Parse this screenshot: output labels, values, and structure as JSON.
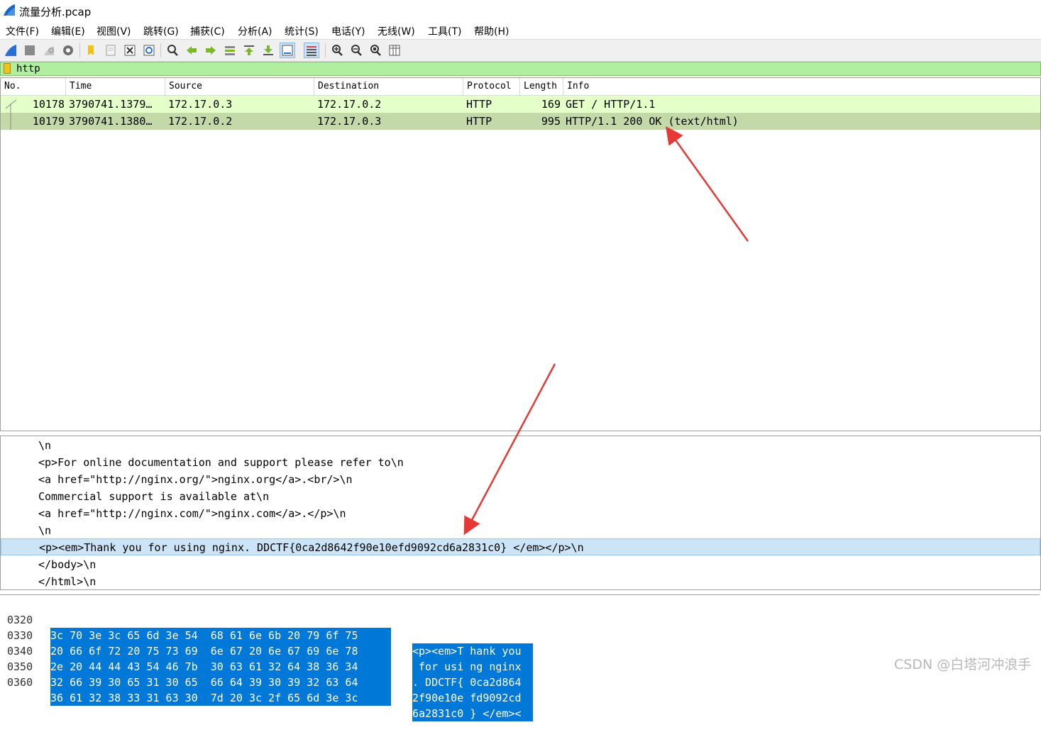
{
  "window": {
    "title": "流量分析.pcap"
  },
  "menu": [
    "文件(F)",
    "编辑(E)",
    "视图(V)",
    "跳转(G)",
    "捕获(C)",
    "分析(A)",
    "统计(S)",
    "电话(Y)",
    "无线(W)",
    "工具(T)",
    "帮助(H)"
  ],
  "toolbar": {
    "icons": [
      "shark-fin-start-icon",
      "stop-capture-icon",
      "restart-capture-icon",
      "capture-options-icon",
      "open-file-icon",
      "save-file-icon",
      "close-file-icon",
      "reload-file-icon",
      "find-packet-icon",
      "go-back-icon",
      "go-forward-icon",
      "go-to-packet-icon",
      "go-first-packet-icon",
      "go-last-packet-icon",
      "auto-scroll-icon",
      "colorize-icon",
      "zoom-in-icon",
      "zoom-out-icon",
      "normal-size-icon",
      "resize-columns-icon"
    ]
  },
  "filter": {
    "value": "http"
  },
  "packet_list": {
    "columns": [
      "No.",
      "Time",
      "Source",
      "Destination",
      "Protocol",
      "Length",
      "Info"
    ],
    "rows": [
      {
        "no": "10178",
        "time": "3790741.1379…",
        "source": "172.17.0.3",
        "destination": "172.17.0.2",
        "protocol": "HTTP",
        "length": "169",
        "info": "GET / HTTP/1.1"
      },
      {
        "no": "10179",
        "time": "3790741.1380…",
        "source": "172.17.0.2",
        "destination": "172.17.0.3",
        "protocol": "HTTP",
        "length": "995",
        "info": "HTTP/1.1 200 OK  (text/html)"
      }
    ]
  },
  "details": {
    "lines": [
      "\\n",
      "<p>For online documentation and support please refer to\\n",
      "<a href=\"http://nginx.org/\">nginx.org</a>.<br/>\\n",
      "Commercial support is available at\\n",
      "<a href=\"http://nginx.com/\">nginx.com</a>.</p>\\n",
      "\\n",
      "<p><em>Thank you for using nginx. DDCTF{0ca2d8642f90e10efd9092cd6a2831c0} </em></p>\\n",
      "</body>\\n",
      "</html>\\n"
    ],
    "selected_index": 6
  },
  "bytes": {
    "rows": [
      {
        "offset": "0320",
        "hex": "3c 70 3e 3c 65 6d 3e 54  68 61 6e 6b 20 79 6f 75",
        "ascii": "<p><em>T hank you"
      },
      {
        "offset": "0330",
        "hex": "20 66 6f 72 20 75 73 69  6e 67 20 6e 67 69 6e 78",
        "ascii": " for usi ng nginx"
      },
      {
        "offset": "0340",
        "hex": "2e 20 44 44 43 54 46 7b  30 63 61 32 64 38 36 34",
        "ascii": ". DDCTF{ 0ca2d864"
      },
      {
        "offset": "0350",
        "hex": "32 66 39 30 65 31 30 65  66 64 39 30 39 32 63 64",
        "ascii": "2f90e10e fd9092cd"
      },
      {
        "offset": "0360",
        "hex": "36 61 32 38 33 31 63 30  7d 20 3c 2f 65 6d 3e 3c",
        "ascii": "6a2831c0 } </em><"
      }
    ]
  },
  "watermark": "CSDN @白塔河冲浪手",
  "colors": {
    "filter_bg": "#afef9f",
    "row_http_bg": "#e4ffc7",
    "row_selected_bg": "#c3d9a8",
    "detail_selected_bg": "#cce4f7",
    "bytes_highlight": "#0078d7",
    "arrow": "#e53935"
  }
}
